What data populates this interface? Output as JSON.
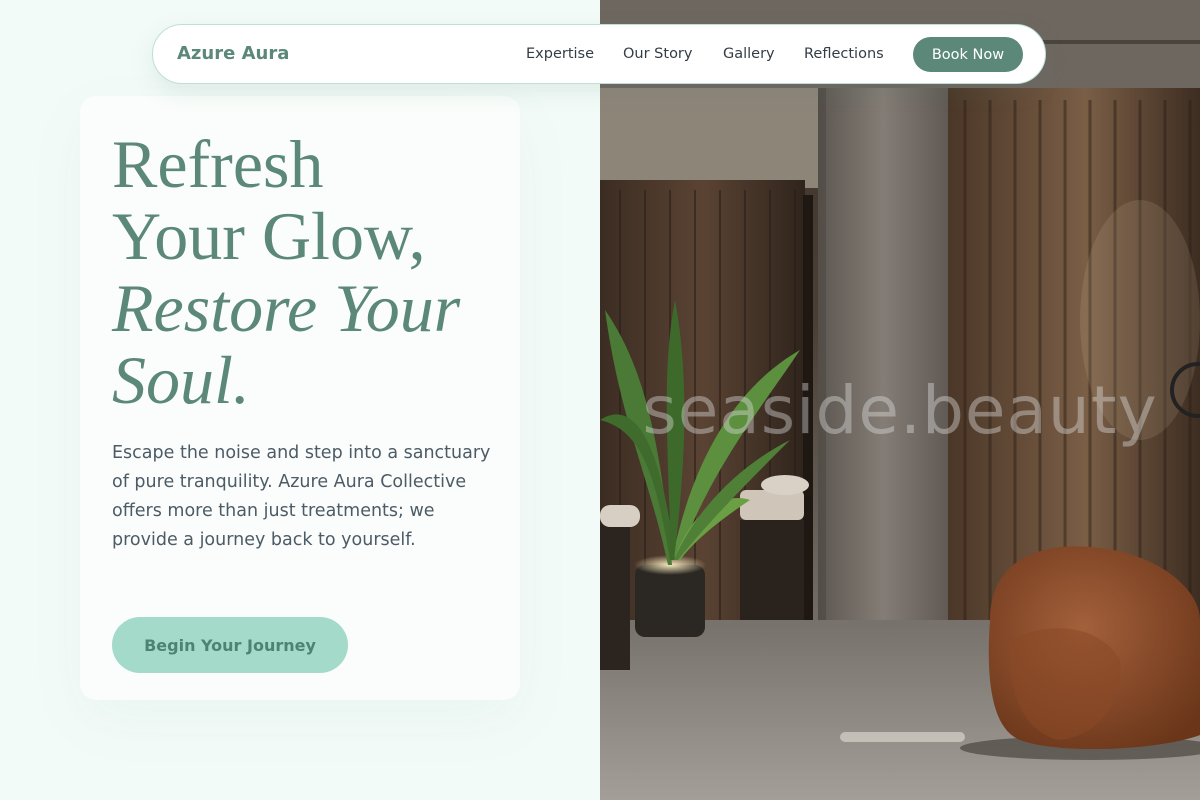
{
  "header": {
    "brand": "Azure Aura",
    "nav": [
      "Expertise",
      "Our Story",
      "Gallery",
      "Reflections"
    ],
    "book_label": "Book Now"
  },
  "hero": {
    "title_line1": "Refresh",
    "title_line2": "Your Glow,",
    "title_line3": "Restore Your",
    "title_line4": "Soul.",
    "description": "Escape the noise and step into a sanctuary of pure tranquility. Azure Aura Collective offers more than just treatments; we provide a journey back to yourself.",
    "cta_label": "Begin Your Journey"
  },
  "image": {
    "watermark": "seaside.beauty"
  },
  "colors": {
    "accent": "#5b8878",
    "cta_background": "#a4dac9",
    "page_background": "#f3fbf8",
    "text": "#4d5b66"
  }
}
